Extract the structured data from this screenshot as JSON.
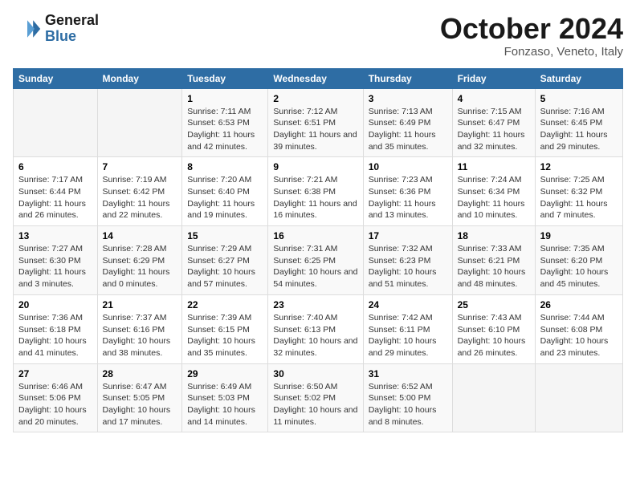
{
  "logo": {
    "text_general": "General",
    "text_blue": "Blue"
  },
  "header": {
    "month_title": "October 2024",
    "location": "Fonzaso, Veneto, Italy"
  },
  "weekdays": [
    "Sunday",
    "Monday",
    "Tuesday",
    "Wednesday",
    "Thursday",
    "Friday",
    "Saturday"
  ],
  "weeks": [
    [
      {
        "day": "",
        "sunrise": "",
        "sunset": "",
        "daylight": ""
      },
      {
        "day": "",
        "sunrise": "",
        "sunset": "",
        "daylight": ""
      },
      {
        "day": "1",
        "sunrise": "Sunrise: 7:11 AM",
        "sunset": "Sunset: 6:53 PM",
        "daylight": "Daylight: 11 hours and 42 minutes."
      },
      {
        "day": "2",
        "sunrise": "Sunrise: 7:12 AM",
        "sunset": "Sunset: 6:51 PM",
        "daylight": "Daylight: 11 hours and 39 minutes."
      },
      {
        "day": "3",
        "sunrise": "Sunrise: 7:13 AM",
        "sunset": "Sunset: 6:49 PM",
        "daylight": "Daylight: 11 hours and 35 minutes."
      },
      {
        "day": "4",
        "sunrise": "Sunrise: 7:15 AM",
        "sunset": "Sunset: 6:47 PM",
        "daylight": "Daylight: 11 hours and 32 minutes."
      },
      {
        "day": "5",
        "sunrise": "Sunrise: 7:16 AM",
        "sunset": "Sunset: 6:45 PM",
        "daylight": "Daylight: 11 hours and 29 minutes."
      }
    ],
    [
      {
        "day": "6",
        "sunrise": "Sunrise: 7:17 AM",
        "sunset": "Sunset: 6:44 PM",
        "daylight": "Daylight: 11 hours and 26 minutes."
      },
      {
        "day": "7",
        "sunrise": "Sunrise: 7:19 AM",
        "sunset": "Sunset: 6:42 PM",
        "daylight": "Daylight: 11 hours and 22 minutes."
      },
      {
        "day": "8",
        "sunrise": "Sunrise: 7:20 AM",
        "sunset": "Sunset: 6:40 PM",
        "daylight": "Daylight: 11 hours and 19 minutes."
      },
      {
        "day": "9",
        "sunrise": "Sunrise: 7:21 AM",
        "sunset": "Sunset: 6:38 PM",
        "daylight": "Daylight: 11 hours and 16 minutes."
      },
      {
        "day": "10",
        "sunrise": "Sunrise: 7:23 AM",
        "sunset": "Sunset: 6:36 PM",
        "daylight": "Daylight: 11 hours and 13 minutes."
      },
      {
        "day": "11",
        "sunrise": "Sunrise: 7:24 AM",
        "sunset": "Sunset: 6:34 PM",
        "daylight": "Daylight: 11 hours and 10 minutes."
      },
      {
        "day": "12",
        "sunrise": "Sunrise: 7:25 AM",
        "sunset": "Sunset: 6:32 PM",
        "daylight": "Daylight: 11 hours and 7 minutes."
      }
    ],
    [
      {
        "day": "13",
        "sunrise": "Sunrise: 7:27 AM",
        "sunset": "Sunset: 6:30 PM",
        "daylight": "Daylight: 11 hours and 3 minutes."
      },
      {
        "day": "14",
        "sunrise": "Sunrise: 7:28 AM",
        "sunset": "Sunset: 6:29 PM",
        "daylight": "Daylight: 11 hours and 0 minutes."
      },
      {
        "day": "15",
        "sunrise": "Sunrise: 7:29 AM",
        "sunset": "Sunset: 6:27 PM",
        "daylight": "Daylight: 10 hours and 57 minutes."
      },
      {
        "day": "16",
        "sunrise": "Sunrise: 7:31 AM",
        "sunset": "Sunset: 6:25 PM",
        "daylight": "Daylight: 10 hours and 54 minutes."
      },
      {
        "day": "17",
        "sunrise": "Sunrise: 7:32 AM",
        "sunset": "Sunset: 6:23 PM",
        "daylight": "Daylight: 10 hours and 51 minutes."
      },
      {
        "day": "18",
        "sunrise": "Sunrise: 7:33 AM",
        "sunset": "Sunset: 6:21 PM",
        "daylight": "Daylight: 10 hours and 48 minutes."
      },
      {
        "day": "19",
        "sunrise": "Sunrise: 7:35 AM",
        "sunset": "Sunset: 6:20 PM",
        "daylight": "Daylight: 10 hours and 45 minutes."
      }
    ],
    [
      {
        "day": "20",
        "sunrise": "Sunrise: 7:36 AM",
        "sunset": "Sunset: 6:18 PM",
        "daylight": "Daylight: 10 hours and 41 minutes."
      },
      {
        "day": "21",
        "sunrise": "Sunrise: 7:37 AM",
        "sunset": "Sunset: 6:16 PM",
        "daylight": "Daylight: 10 hours and 38 minutes."
      },
      {
        "day": "22",
        "sunrise": "Sunrise: 7:39 AM",
        "sunset": "Sunset: 6:15 PM",
        "daylight": "Daylight: 10 hours and 35 minutes."
      },
      {
        "day": "23",
        "sunrise": "Sunrise: 7:40 AM",
        "sunset": "Sunset: 6:13 PM",
        "daylight": "Daylight: 10 hours and 32 minutes."
      },
      {
        "day": "24",
        "sunrise": "Sunrise: 7:42 AM",
        "sunset": "Sunset: 6:11 PM",
        "daylight": "Daylight: 10 hours and 29 minutes."
      },
      {
        "day": "25",
        "sunrise": "Sunrise: 7:43 AM",
        "sunset": "Sunset: 6:10 PM",
        "daylight": "Daylight: 10 hours and 26 minutes."
      },
      {
        "day": "26",
        "sunrise": "Sunrise: 7:44 AM",
        "sunset": "Sunset: 6:08 PM",
        "daylight": "Daylight: 10 hours and 23 minutes."
      }
    ],
    [
      {
        "day": "27",
        "sunrise": "Sunrise: 6:46 AM",
        "sunset": "Sunset: 5:06 PM",
        "daylight": "Daylight: 10 hours and 20 minutes."
      },
      {
        "day": "28",
        "sunrise": "Sunrise: 6:47 AM",
        "sunset": "Sunset: 5:05 PM",
        "daylight": "Daylight: 10 hours and 17 minutes."
      },
      {
        "day": "29",
        "sunrise": "Sunrise: 6:49 AM",
        "sunset": "Sunset: 5:03 PM",
        "daylight": "Daylight: 10 hours and 14 minutes."
      },
      {
        "day": "30",
        "sunrise": "Sunrise: 6:50 AM",
        "sunset": "Sunset: 5:02 PM",
        "daylight": "Daylight: 10 hours and 11 minutes."
      },
      {
        "day": "31",
        "sunrise": "Sunrise: 6:52 AM",
        "sunset": "Sunset: 5:00 PM",
        "daylight": "Daylight: 10 hours and 8 minutes."
      },
      {
        "day": "",
        "sunrise": "",
        "sunset": "",
        "daylight": ""
      },
      {
        "day": "",
        "sunrise": "",
        "sunset": "",
        "daylight": ""
      }
    ]
  ]
}
